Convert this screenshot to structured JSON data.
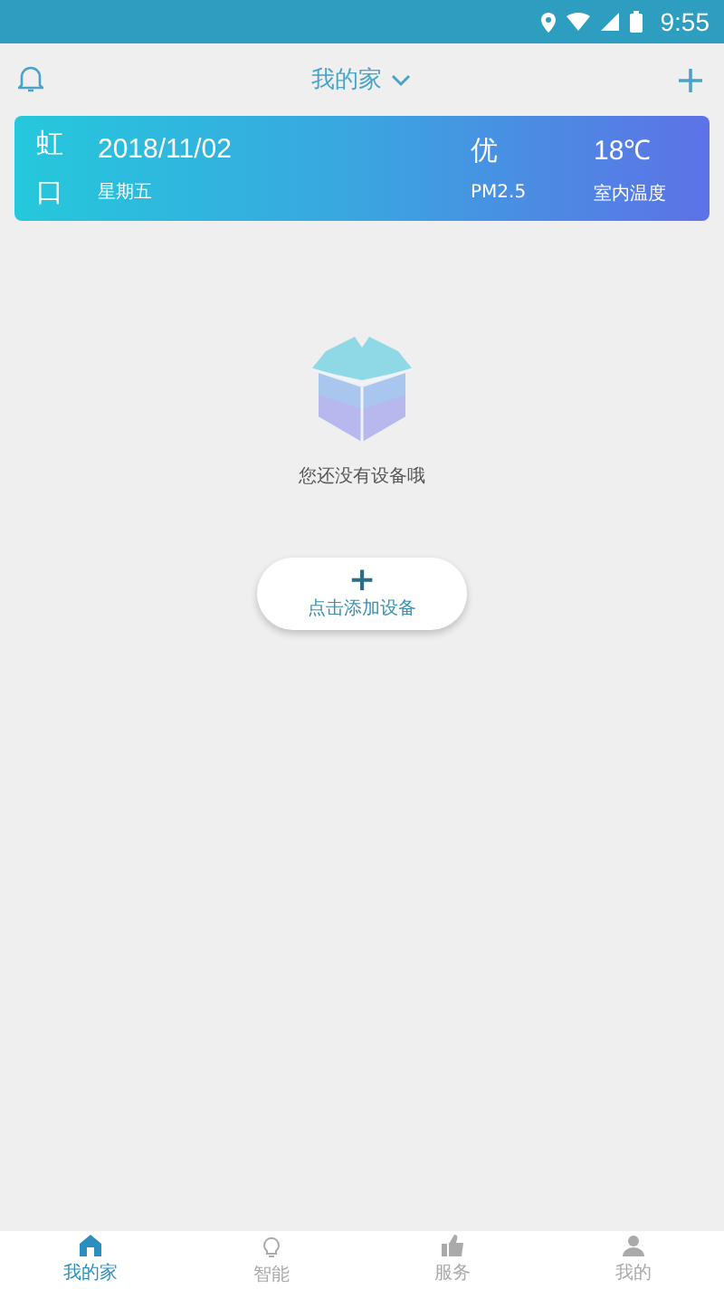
{
  "status_bar": {
    "time": "9:55"
  },
  "header": {
    "title": "我的家"
  },
  "weather_card": {
    "city_line_1": "虹",
    "city_line_2": "口",
    "date": "2018/11/02",
    "weekday": "星期五",
    "air_quality": "优",
    "air_label": "PM2.5",
    "temperature": "18℃",
    "temperature_label": "室内温度"
  },
  "empty_state": {
    "message": "您还没有设备哦",
    "add_button": {
      "icon": "+",
      "label": "点击添加设备"
    }
  },
  "bottom_nav": [
    {
      "kind": "home",
      "label": "我的家",
      "selected": true
    },
    {
      "kind": "smart",
      "label": "智能",
      "selected": false
    },
    {
      "kind": "service",
      "label": "服务",
      "selected": false
    },
    {
      "kind": "me",
      "label": "我的",
      "selected": false
    }
  ]
}
